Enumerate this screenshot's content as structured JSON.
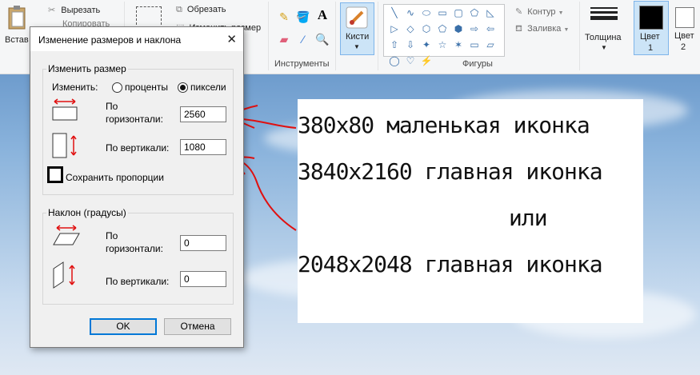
{
  "ribbon": {
    "clipboard": {
      "paste_label": "Встав",
      "cut_label": "Вырезать",
      "copy_label": "Копировать"
    },
    "image": {
      "crop_label": "Обрезать",
      "resize_label": "Изменить размер"
    },
    "tools_label": "Инструменты",
    "brushes_label": "Кисти",
    "shapes_label": "Фигуры",
    "outline_label": "Контур",
    "fill_label": "Заливка",
    "size_label": "Толщина",
    "color1_label": "Цвет",
    "color1_num": "1",
    "color2_label": "Цвет",
    "color2_num": "2",
    "color1_value": "#000000",
    "color2_value": "#ffffff"
  },
  "dialog": {
    "title": "Изменение размеров и наклона",
    "resize_group": "Изменить размер",
    "by_label": "Изменить:",
    "percent_label": "проценты",
    "pixels_label": "пиксели",
    "selected_unit": "pixels",
    "h_label_1": "По",
    "h_label_2": "горизонтали:",
    "h_value": "2560",
    "v_label": "По вертикали:",
    "v_value": "1080",
    "keep_ratio_label": "Сохранить пропорции",
    "skew_group": "Наклон (градусы)",
    "skew_h_label_1": "По",
    "skew_h_label_2": "горизонтали:",
    "skew_h_value": "0",
    "skew_v_label": "По вертикали:",
    "skew_v_value": "0",
    "ok_label": "OK",
    "cancel_label": "Отмена"
  },
  "note": {
    "line1": "380x80 маленькая иконка",
    "line2": "3840x2160 главная иконка",
    "line3": "или",
    "line4": "2048x2048 главная иконка"
  }
}
